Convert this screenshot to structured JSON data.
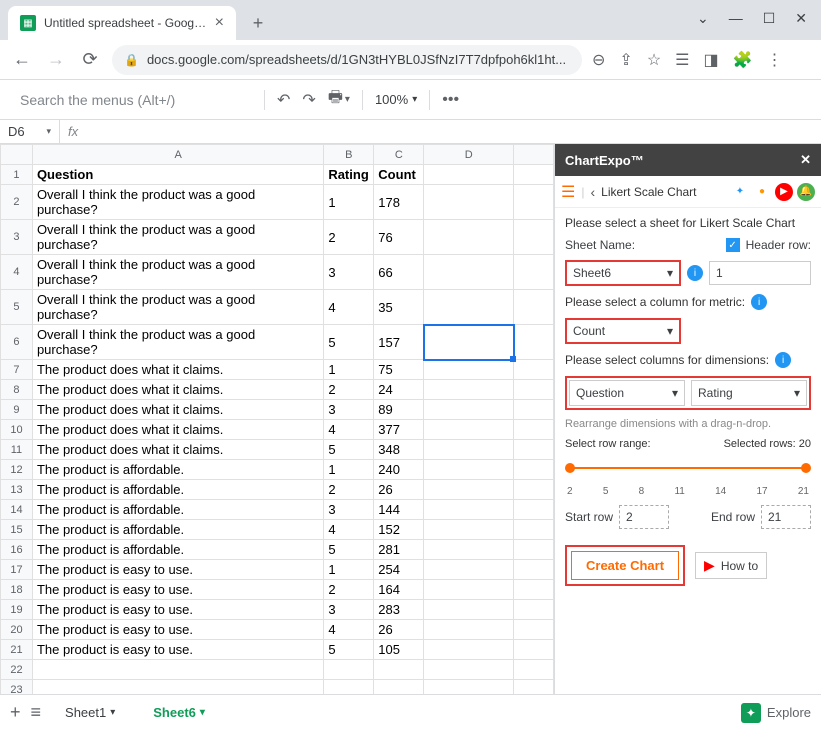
{
  "browser": {
    "tab_title": "Untitled spreadsheet - Google Sh",
    "url": "docs.google.com/spreadsheets/d/1GN3tHYBL0JSfNzI7T7dpfpoh6kl1ht..."
  },
  "toolbar": {
    "menu_search_placeholder": "Search the menus (Alt+/)",
    "zoom": "100%"
  },
  "namebox": {
    "cell": "D6",
    "fx_label": "fx"
  },
  "columns": [
    "A",
    "B",
    "C",
    "D"
  ],
  "headers": {
    "q": "Question",
    "r": "Rating",
    "c": "Count"
  },
  "rows": [
    {
      "q": "Overall I think the product was a good purchase?",
      "r": "1",
      "c": "178"
    },
    {
      "q": "Overall I think the product was a good purchase?",
      "r": "2",
      "c": "76"
    },
    {
      "q": "Overall I think the product was a good purchase?",
      "r": "3",
      "c": "66"
    },
    {
      "q": "Overall I think the product was a good purchase?",
      "r": "4",
      "c": "35"
    },
    {
      "q": "Overall I think the product was a good purchase?",
      "r": "5",
      "c": "157"
    },
    {
      "q": "The product does what it claims.",
      "r": "1",
      "c": "75"
    },
    {
      "q": "The product does what it claims.",
      "r": "2",
      "c": "24"
    },
    {
      "q": "The product does what it claims.",
      "r": "3",
      "c": "89"
    },
    {
      "q": "The product does what it claims.",
      "r": "4",
      "c": "377"
    },
    {
      "q": "The product does what it claims.",
      "r": "5",
      "c": "348"
    },
    {
      "q": "The product is affordable.",
      "r": "1",
      "c": "240"
    },
    {
      "q": "The product is affordable.",
      "r": "2",
      "c": "26"
    },
    {
      "q": "The product is affordable.",
      "r": "3",
      "c": "144"
    },
    {
      "q": "The product is affordable.",
      "r": "4",
      "c": "152"
    },
    {
      "q": "The product is affordable.",
      "r": "5",
      "c": "281"
    },
    {
      "q": "The product is easy to use.",
      "r": "1",
      "c": "254"
    },
    {
      "q": "The product is easy to use.",
      "r": "2",
      "c": "164"
    },
    {
      "q": "The product is easy to use.",
      "r": "3",
      "c": "283"
    },
    {
      "q": "The product is easy to use.",
      "r": "4",
      "c": "26"
    },
    {
      "q": "The product is easy to use.",
      "r": "5",
      "c": "105"
    }
  ],
  "sidebar": {
    "header": "ChartExpo™",
    "title": "Likert Scale Chart",
    "select_sheet_label": "Please select a sheet for Likert Scale Chart",
    "sheet_name_label": "Sheet Name:",
    "header_row_label": "Header row:",
    "header_row_value": "1",
    "sheet_selected": "Sheet6",
    "metric_label": "Please select a column for metric:",
    "metric_selected": "Count",
    "dims_label": "Please select columns for dimensions:",
    "dim1": "Question",
    "dim2": "Rating",
    "dims_hint": "Rearrange dimensions with a drag-n-drop.",
    "range_label": "Select row range:",
    "selected_rows": "Selected rows: 20",
    "ticks": [
      "2",
      "5",
      "8",
      "11",
      "14",
      "17",
      "21"
    ],
    "start_row_label": "Start row",
    "start_row": "2",
    "end_row_label": "End row",
    "end_row": "21",
    "create_chart": "Create Chart",
    "how_to": "How to"
  },
  "footer": {
    "sheet1": "Sheet1",
    "sheet6": "Sheet6",
    "explore": "Explore"
  }
}
